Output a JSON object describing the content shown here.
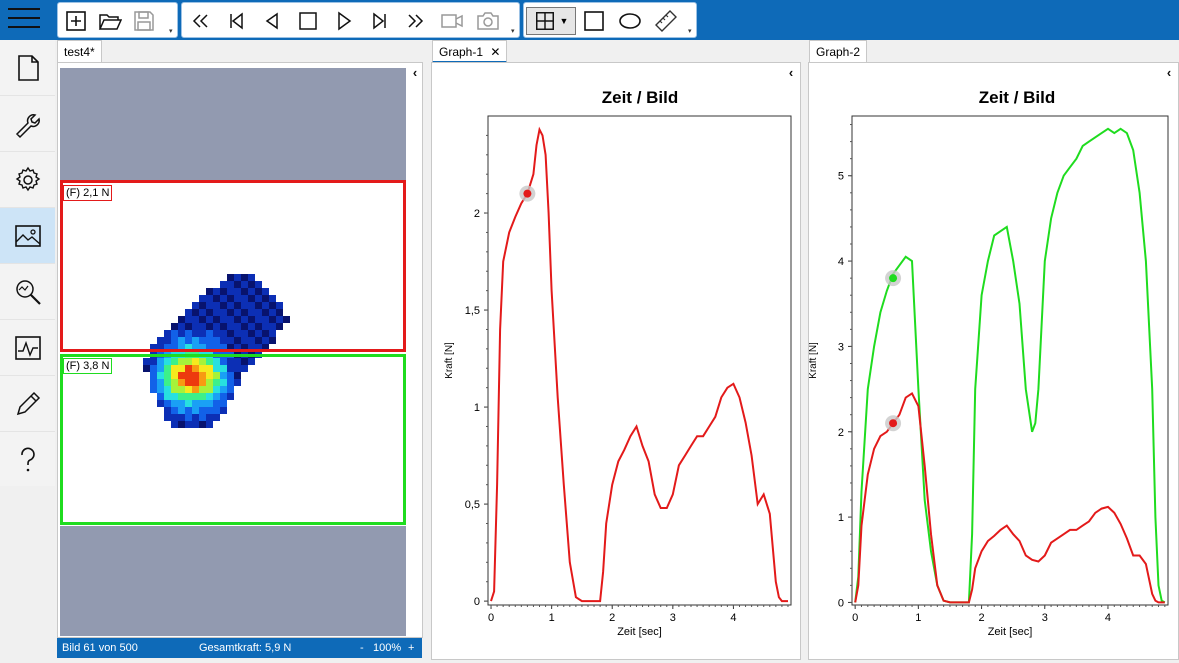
{
  "toolbar": {
    "file_buttons": [
      "new-icon",
      "open-icon",
      "save-icon"
    ],
    "playback_buttons": [
      "rewind-icon",
      "skip-start-icon",
      "step-back-icon",
      "stop-icon",
      "play-icon",
      "skip-end-icon",
      "fast-forward-icon",
      "record-video-icon",
      "snapshot-icon"
    ],
    "draw_buttons": [
      "grid-icon",
      "rectangle-icon",
      "ellipse-icon",
      "ruler-icon"
    ]
  },
  "nav": {
    "items": [
      "document-icon",
      "wrench-icon",
      "gear-icon",
      "image-icon",
      "analyze-icon",
      "chart-icon",
      "pencil-icon",
      "help-icon"
    ],
    "active_index": 3
  },
  "tabs": {
    "image_tab": "test4*",
    "graph1_tab": "Graph-1",
    "graph2_tab": "Graph-2"
  },
  "image_panel": {
    "roi_red_label": "(F) 2,1 N",
    "roi_green_label": "(F) 3,8 N",
    "roi_red_color": "#e31a1a",
    "roi_green_color": "#1fdc1f"
  },
  "status": {
    "frame": "Bild 61 von 500",
    "total_force": "Gesamtkraft: 5,9 N",
    "zoom_minus": "-",
    "zoom": "100%",
    "zoom_plus": "+"
  },
  "colors": {
    "accent": "#0e6ab8",
    "nav_active": "#cde4f7"
  },
  "chart_data": [
    {
      "type": "line",
      "title": "Zeit / Bild",
      "xlabel": "Zeit [sec]",
      "ylabel": "Kraft [N]",
      "xlim": [
        -0.05,
        4.95
      ],
      "ylim": [
        -0.02,
        2.5
      ],
      "xticks": [
        0,
        1,
        2,
        3,
        4
      ],
      "xtick_labels": [
        "0",
        "1",
        "2",
        "3",
        "4"
      ],
      "yticks": [
        0,
        0.5,
        1,
        1.5,
        2
      ],
      "ytick_labels": [
        "0",
        "0,5",
        "1",
        "1,5",
        "2"
      ],
      "marker": {
        "x": 0.6,
        "y": 2.1,
        "color": "#e31a1a"
      },
      "series": [
        {
          "color": "#e31a1a",
          "x": [
            0,
            0.05,
            0.1,
            0.15,
            0.2,
            0.3,
            0.4,
            0.5,
            0.6,
            0.7,
            0.75,
            0.8,
            0.85,
            0.9,
            0.95,
            1.0,
            1.1,
            1.2,
            1.3,
            1.4,
            1.5,
            1.6,
            1.7,
            1.8,
            1.85,
            1.9,
            2.0,
            2.1,
            2.2,
            2.3,
            2.4,
            2.5,
            2.6,
            2.7,
            2.8,
            2.9,
            3.0,
            3.1,
            3.2,
            3.3,
            3.4,
            3.5,
            3.6,
            3.7,
            3.8,
            3.9,
            4.0,
            4.1,
            4.2,
            4.3,
            4.4,
            4.5,
            4.6,
            4.7,
            4.75,
            4.8,
            4.85,
            4.9
          ],
          "y": [
            0,
            0.05,
            0.6,
            1.4,
            1.75,
            1.9,
            1.98,
            2.05,
            2.1,
            2.2,
            2.35,
            2.43,
            2.4,
            2.3,
            2.0,
            1.6,
            1.05,
            0.6,
            0.2,
            0.02,
            0,
            0,
            0,
            0,
            0.15,
            0.4,
            0.6,
            0.72,
            0.78,
            0.85,
            0.9,
            0.8,
            0.72,
            0.55,
            0.48,
            0.48,
            0.55,
            0.7,
            0.75,
            0.8,
            0.85,
            0.85,
            0.9,
            0.95,
            1.05,
            1.1,
            1.12,
            1.05,
            0.92,
            0.75,
            0.5,
            0.55,
            0.45,
            0.1,
            0.02,
            0,
            0,
            0
          ]
        }
      ]
    },
    {
      "type": "line",
      "title": "Zeit / Bild",
      "xlabel": "Zeit [sec]",
      "ylabel": "Kraft [N]",
      "xlim": [
        -0.05,
        4.95
      ],
      "ylim": [
        -0.03,
        5.7
      ],
      "xticks": [
        0,
        1,
        2,
        3,
        4
      ],
      "xtick_labels": [
        "0",
        "1",
        "2",
        "3",
        "4"
      ],
      "yticks": [
        0,
        1,
        2,
        3,
        4,
        5
      ],
      "ytick_labels": [
        "0",
        "1",
        "2",
        "3",
        "4",
        "5"
      ],
      "markers": [
        {
          "x": 0.6,
          "y": 3.8,
          "color": "#1fdc1f"
        },
        {
          "x": 0.6,
          "y": 2.1,
          "color": "#e31a1a"
        }
      ],
      "series": [
        {
          "color": "#1fdc1f",
          "x": [
            0,
            0.05,
            0.1,
            0.2,
            0.3,
            0.4,
            0.5,
            0.6,
            0.7,
            0.8,
            0.9,
            1.0,
            1.1,
            1.2,
            1.3,
            1.4,
            1.5,
            1.6,
            1.7,
            1.8,
            1.85,
            1.9,
            2.0,
            2.1,
            2.2,
            2.3,
            2.4,
            2.5,
            2.6,
            2.7,
            2.8,
            2.85,
            2.9,
            3.0,
            3.1,
            3.2,
            3.3,
            3.4,
            3.5,
            3.6,
            3.7,
            3.8,
            3.9,
            4.0,
            4.1,
            4.2,
            4.3,
            4.4,
            4.5,
            4.6,
            4.7,
            4.75,
            4.8,
            4.85,
            4.9
          ],
          "y": [
            0,
            0.3,
            1.3,
            2.5,
            3.0,
            3.4,
            3.65,
            3.85,
            3.95,
            4.05,
            4.0,
            2.5,
            1.2,
            0.6,
            0.2,
            0.02,
            0,
            0,
            0,
            0,
            0.8,
            2.5,
            3.6,
            4.0,
            4.3,
            4.35,
            4.4,
            4.0,
            3.5,
            2.5,
            2.0,
            2.1,
            2.5,
            4.0,
            4.5,
            4.8,
            5.0,
            5.1,
            5.2,
            5.35,
            5.4,
            5.45,
            5.5,
            5.55,
            5.5,
            5.55,
            5.5,
            5.3,
            4.8,
            4.0,
            2.5,
            1.0,
            0.2,
            0.02,
            0
          ]
        },
        {
          "color": "#e31a1a",
          "x": [
            0,
            0.05,
            0.1,
            0.2,
            0.3,
            0.4,
            0.5,
            0.6,
            0.7,
            0.8,
            0.9,
            1.0,
            1.1,
            1.2,
            1.3,
            1.4,
            1.5,
            1.6,
            1.7,
            1.8,
            1.85,
            1.9,
            2.0,
            2.1,
            2.2,
            2.3,
            2.4,
            2.5,
            2.6,
            2.7,
            2.8,
            2.9,
            3.0,
            3.1,
            3.2,
            3.3,
            3.4,
            3.5,
            3.6,
            3.7,
            3.8,
            3.9,
            4.0,
            4.1,
            4.2,
            4.3,
            4.4,
            4.5,
            4.6,
            4.7,
            4.75,
            4.8,
            4.85,
            4.9
          ],
          "y": [
            0,
            0.2,
            0.9,
            1.5,
            1.8,
            1.95,
            2.0,
            2.1,
            2.2,
            2.4,
            2.45,
            2.3,
            1.6,
            0.8,
            0.2,
            0.02,
            0,
            0,
            0,
            0,
            0.15,
            0.4,
            0.6,
            0.72,
            0.78,
            0.85,
            0.9,
            0.8,
            0.72,
            0.55,
            0.5,
            0.48,
            0.55,
            0.7,
            0.75,
            0.8,
            0.85,
            0.85,
            0.9,
            0.95,
            1.05,
            1.1,
            1.12,
            1.05,
            0.92,
            0.75,
            0.55,
            0.55,
            0.45,
            0.1,
            0.02,
            0,
            0,
            0
          ]
        }
      ]
    }
  ]
}
